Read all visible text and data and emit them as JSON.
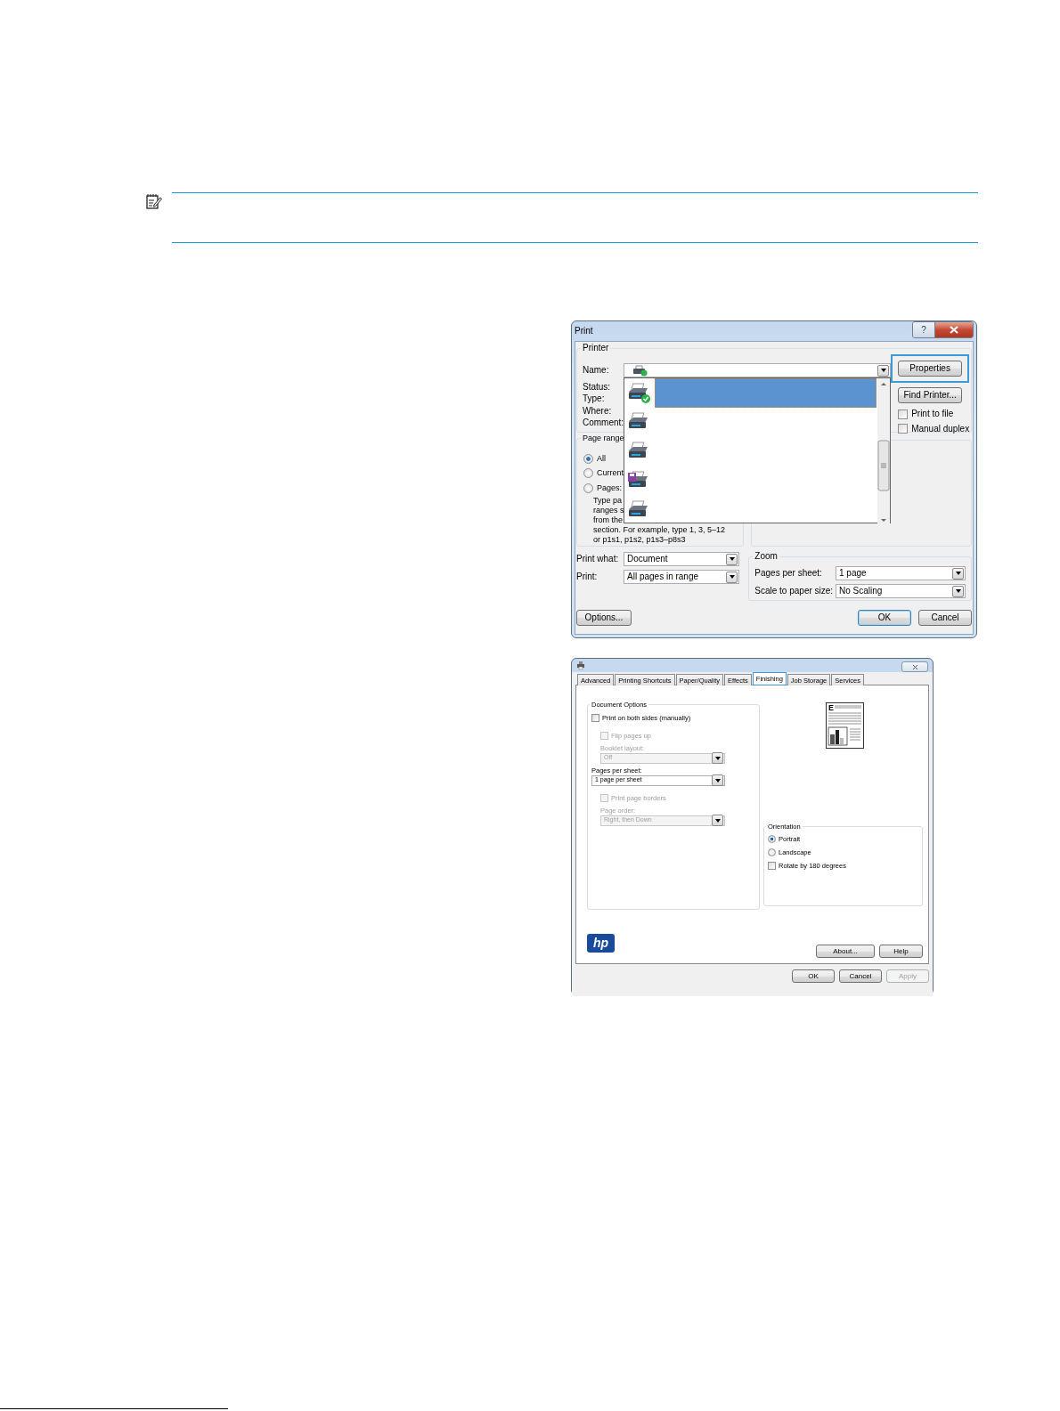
{
  "print_dialog": {
    "title": "Print",
    "help_button": "?",
    "printer_group": {
      "label": "Printer",
      "field_labels": [
        "Name:",
        "Status:",
        "Type:",
        "Where:",
        "Comment:"
      ]
    },
    "properties_button": {
      "label": "Properties",
      "highlighted": true
    },
    "find_printer_button": {
      "label": "Find Printer..."
    },
    "checkboxes": [
      {
        "label": "Print to file",
        "checked": false
      },
      {
        "label": "Manual duplex",
        "checked": false
      }
    ],
    "printer_list": [
      {
        "kind": "default",
        "selected": true
      },
      {
        "kind": "printer",
        "selected": false
      },
      {
        "kind": "printer",
        "selected": false
      },
      {
        "kind": "fax",
        "selected": false
      },
      {
        "kind": "printer",
        "selected": false
      }
    ],
    "page_range": {
      "label": "Page range",
      "options": [
        {
          "label": "All",
          "selected": true
        },
        {
          "label": "Current",
          "selected": false
        },
        {
          "label": "Pages:",
          "selected": false
        }
      ],
      "hint_lines": [
        "Type pa",
        "ranges s",
        "from the",
        "section. For example, type 1, 3, 5–12",
        "or p1s1, p1s2, p1s3–p8s3"
      ]
    },
    "print_what": {
      "label": "Print what:",
      "value": "Document"
    },
    "print": {
      "label": "Print:",
      "value": "All pages in range"
    },
    "zoom": {
      "label": "Zoom",
      "fields": [
        {
          "label": "Pages per sheet:",
          "value": "1 page"
        },
        {
          "label": "Scale to paper size:",
          "value": "No Scaling"
        }
      ]
    },
    "buttons": [
      {
        "label": "Options...",
        "kind": "left"
      },
      {
        "label": "OK",
        "kind": "default"
      },
      {
        "label": "Cancel",
        "kind": "normal"
      }
    ]
  },
  "properties_dialog": {
    "tabs": [
      {
        "label": "Advanced",
        "selected": false,
        "highlighted": false
      },
      {
        "label": "Printing Shortcuts",
        "selected": false,
        "highlighted": false
      },
      {
        "label": "Paper/Quality",
        "selected": false,
        "highlighted": false
      },
      {
        "label": "Effects",
        "selected": false,
        "highlighted": false
      },
      {
        "label": "Finishing",
        "selected": true,
        "highlighted": true
      },
      {
        "label": "Job Storage",
        "selected": false,
        "highlighted": false
      },
      {
        "label": "Services",
        "selected": false,
        "highlighted": false
      }
    ],
    "document_options": {
      "label": "Document Options",
      "items": [
        {
          "kind": "checkbox",
          "label": "Print on both sides (manually)",
          "checked": false,
          "disabled": false,
          "indent": false
        },
        {
          "kind": "checkbox",
          "label": "Flip pages up",
          "checked": false,
          "disabled": true,
          "indent": true
        },
        {
          "kind": "label",
          "label": "Booklet layout:",
          "disabled": true,
          "indent": true
        },
        {
          "kind": "select",
          "value": "Off",
          "disabled": true,
          "indent": true
        },
        {
          "kind": "label",
          "label": "Pages per sheet:",
          "disabled": false,
          "indent": false
        },
        {
          "kind": "select",
          "value": "1 page per sheet",
          "disabled": false,
          "indent": false
        },
        {
          "kind": "checkbox",
          "label": "Print page borders",
          "checked": false,
          "disabled": true,
          "indent": true
        },
        {
          "kind": "label",
          "label": "Page order:",
          "disabled": true,
          "indent": true
        },
        {
          "kind": "select",
          "value": "Right, then Down",
          "disabled": true,
          "indent": true
        }
      ]
    },
    "preview": {
      "heading": "E"
    },
    "orientation": {
      "label": "Orientation",
      "options": [
        {
          "label": "Portrait",
          "selected": true
        },
        {
          "label": "Landscape",
          "selected": false
        }
      ],
      "rotate": {
        "label": "Rotate by 180 degrees",
        "checked": false
      }
    },
    "logo": {
      "text": "hp"
    },
    "panel_buttons": [
      {
        "label": "About...",
        "disabled": false
      },
      {
        "label": "Help",
        "disabled": false
      }
    ],
    "buttons": [
      {
        "label": "OK",
        "disabled": false
      },
      {
        "label": "Cancel",
        "disabled": false
      },
      {
        "label": "Apply",
        "disabled": true
      }
    ]
  }
}
